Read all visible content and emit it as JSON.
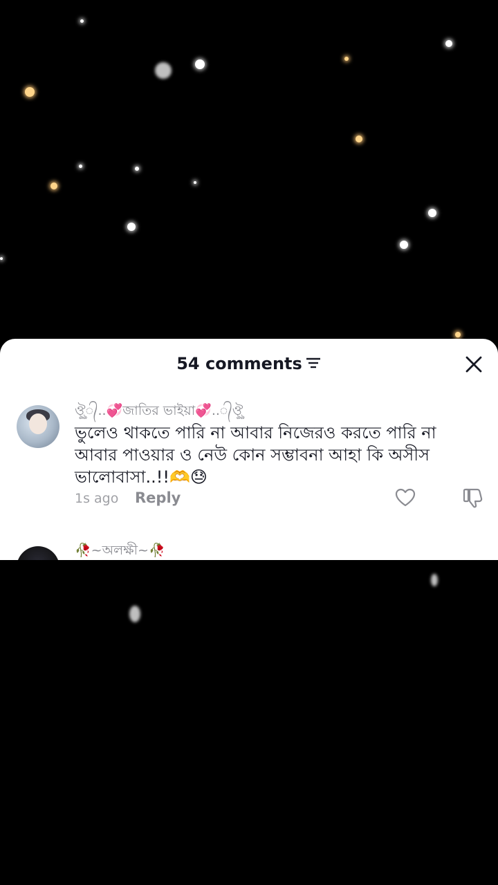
{
  "comments_panel": {
    "title": "54 comments",
    "icons": {
      "filter": "filter-icon",
      "close": "close-icon"
    }
  },
  "comments": [
    {
      "username": "ঔৣ᭄..💞জাতির ভাইয়া💞..᭄ঔৣ",
      "text": "ভুলেও থাকতে পারি না আবার নিজেরও করতে পারি না আবার পাওয়ার ও নেউ কোন সম্ভাবনা আহা কি অসীস ভালোবাসা..!!🫶😓",
      "time": "1s ago",
      "reply_label": "Reply",
      "icons": {
        "like": "heart-icon",
        "dislike": "thumbs-down-icon"
      }
    },
    {
      "username": "🥀~অলক্ষী~🥀"
    }
  ]
}
